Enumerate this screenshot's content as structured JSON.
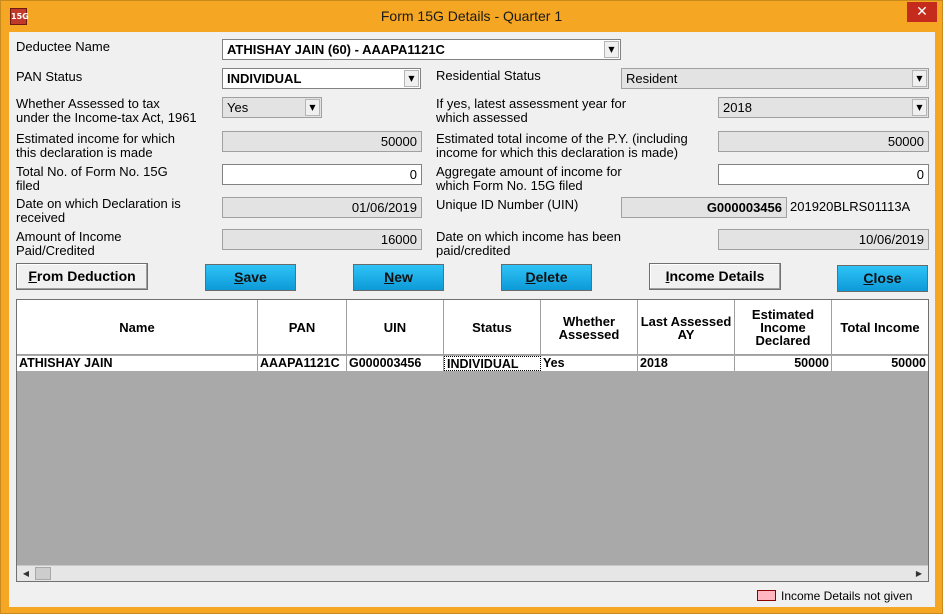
{
  "window": {
    "title": "Form 15G Details - Quarter 1",
    "icon_text": "15G",
    "close_glyph": "✕"
  },
  "form": {
    "deductee_name": {
      "label": "Deductee Name",
      "value": "ATHISHAY JAIN (60) - AAAPA1121C"
    },
    "pan_status": {
      "label": "PAN Status",
      "value": "INDIVIDUAL"
    },
    "residential_status": {
      "label": "Residential Status",
      "value": "Resident"
    },
    "whether_assessed": {
      "label_line1": "Whether Assessed to tax",
      "label_line2": "under the Income-tax Act, 1961",
      "value": "Yes"
    },
    "latest_assessment_year": {
      "label_line1": "If yes, latest assessment year for",
      "label_line2": "which assessed",
      "value": "2018"
    },
    "estimated_income": {
      "label_line1": "Estimated income for which",
      "label_line2": "this declaration is made",
      "value": "50000"
    },
    "estimated_total_income": {
      "label_line1": "Estimated total income of the P.Y. (including",
      "label_line2": "income for which this declaration is made)",
      "value": "50000"
    },
    "total_forms_filed": {
      "label_line1": "Total No. of Form No. 15G",
      "label_line2": "filed",
      "value": "0"
    },
    "aggregate_income": {
      "label_line1": "Aggregate amount of income for",
      "label_line2": "which Form No. 15G filed",
      "value": "0"
    },
    "declaration_date": {
      "label_line1": "Date on which Declaration is",
      "label_line2": "received",
      "value": "01/06/2019"
    },
    "uin": {
      "label": "Unique ID Number (UIN)",
      "value": "G000003456",
      "suffix": "201920BLRS01113A"
    },
    "amount_paid": {
      "label_line1": "Amount of Income",
      "label_line2": "Paid/Credited",
      "value": "16000"
    },
    "income_paid_date": {
      "label_line1": "Date on which income has been",
      "label_line2": "paid/credited",
      "value": "10/06/2019"
    }
  },
  "buttons": {
    "from_deduction": {
      "key": "F",
      "rest": "rom Deduction"
    },
    "save": {
      "key": "S",
      "rest": "ave"
    },
    "new": {
      "key": "N",
      "rest": "ew"
    },
    "delete": {
      "key": "D",
      "rest": "elete"
    },
    "income_details": {
      "key": "I",
      "rest": "ncome Details"
    },
    "close": {
      "key": "C",
      "rest": "lose"
    }
  },
  "table": {
    "headers": {
      "name": "Name",
      "pan": "PAN",
      "uin": "UIN",
      "status": "Status",
      "whether_assessed": "Whether Assessed",
      "last_assessed_ay": "Last Assessed AY",
      "estimated_income_declared": "Estimated Income Declared",
      "total_income": "Total Income"
    },
    "rows": [
      {
        "name": "ATHISHAY JAIN",
        "pan": "AAAPA1121C",
        "uin": "G000003456",
        "status": "INDIVIDUAL",
        "whether_assessed": "Yes",
        "last_assessed_ay": "2018",
        "estimated_income_declared": "50000",
        "total_income": "50000"
      }
    ]
  },
  "legend": {
    "text": "Income Details not given",
    "color": "#ffb6c1"
  },
  "icons": {
    "dropdown": "▼",
    "scroll_left": "◀",
    "scroll_right": "▶"
  }
}
